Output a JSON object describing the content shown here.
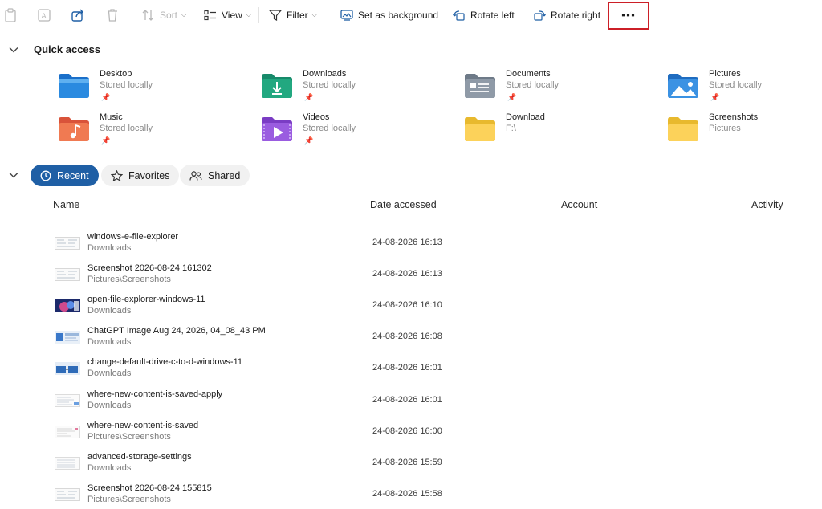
{
  "toolbar": {
    "sort_label": "Sort",
    "view_label": "View",
    "filter_label": "Filter",
    "set_background_label": "Set as background",
    "rotate_left_label": "Rotate left",
    "rotate_right_label": "Rotate right",
    "more_label": "⋯",
    "highlight_color": "#cc1f27"
  },
  "quick_access": {
    "title": "Quick access",
    "items": [
      {
        "name": "Desktop",
        "sub": "Stored locally",
        "icon": "desktop-folder-icon",
        "pinned": true
      },
      {
        "name": "Downloads",
        "sub": "Stored locally",
        "icon": "downloads-folder-icon",
        "pinned": true
      },
      {
        "name": "Documents",
        "sub": "Stored locally",
        "icon": "documents-folder-icon",
        "pinned": true
      },
      {
        "name": "Pictures",
        "sub": "Stored locally",
        "icon": "pictures-folder-icon",
        "pinned": true
      },
      {
        "name": "Music",
        "sub": "Stored locally",
        "icon": "music-folder-icon",
        "pinned": true
      },
      {
        "name": "Videos",
        "sub": "Stored locally",
        "icon": "videos-folder-icon",
        "pinned": true
      },
      {
        "name": "Download",
        "sub": "F:\\",
        "icon": "folder-icon",
        "pinned": false
      },
      {
        "name": "Screenshots",
        "sub": "Pictures",
        "icon": "folder-icon",
        "pinned": false
      }
    ],
    "pin_glyph": "📌"
  },
  "tabs": {
    "recent": "Recent",
    "favorites": "Favorites",
    "shared": "Shared",
    "active_color": "#1f5fa5"
  },
  "table": {
    "columns": {
      "name": "Name",
      "date": "Date accessed",
      "account": "Account",
      "activity": "Activity"
    },
    "rows": [
      {
        "name": "windows-e-file-explorer",
        "location": "Downloads",
        "date": "24-08-2026 16:13"
      },
      {
        "name": "Screenshot 2026-08-24 161302",
        "location": "Pictures\\Screenshots",
        "date": "24-08-2026 16:13"
      },
      {
        "name": "open-file-explorer-windows-11",
        "location": "Downloads",
        "date": "24-08-2026 16:10"
      },
      {
        "name": "ChatGPT Image Aug 24, 2026, 04_08_43 PM",
        "location": "Downloads",
        "date": "24-08-2026 16:08"
      },
      {
        "name": "change-default-drive-c-to-d-windows-11",
        "location": "Downloads",
        "date": "24-08-2026 16:01"
      },
      {
        "name": "where-new-content-is-saved-apply",
        "location": "Downloads",
        "date": "24-08-2026 16:01"
      },
      {
        "name": "where-new-content-is-saved",
        "location": "Pictures\\Screenshots",
        "date": "24-08-2026 16:00"
      },
      {
        "name": "advanced-storage-settings",
        "location": "Downloads",
        "date": "24-08-2026 15:59"
      },
      {
        "name": "Screenshot 2026-08-24 155815",
        "location": "Pictures\\Screenshots",
        "date": "24-08-2026 15:58"
      }
    ]
  }
}
